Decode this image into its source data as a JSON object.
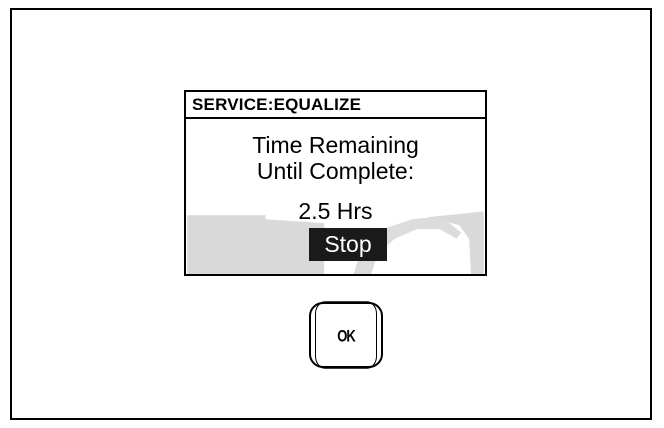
{
  "screen": {
    "title": "SERVICE:EQUALIZE",
    "line1": "Time Remaining",
    "line2": "Until Complete:",
    "line3": "2.5 Hrs",
    "stop_label": "Stop"
  },
  "controls": {
    "ok_label": "OK"
  },
  "colors": {
    "border": "#000000",
    "background": "#ffffff",
    "watermark": "#d9d9d9",
    "stop_button": "#1a1a1a",
    "stop_text": "#ffffff"
  }
}
